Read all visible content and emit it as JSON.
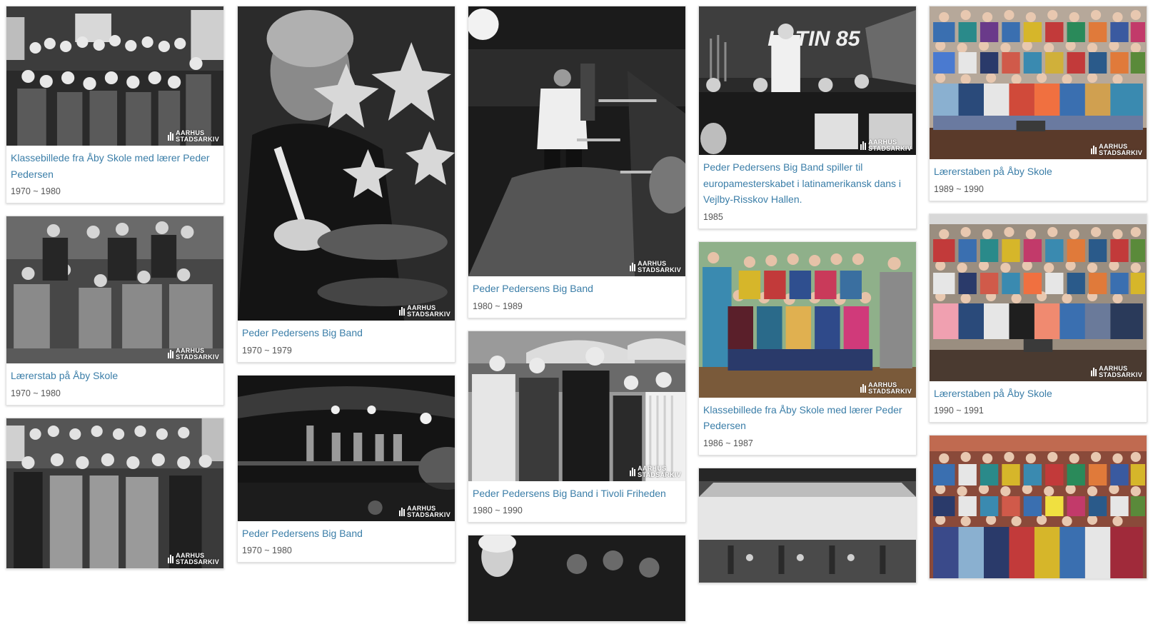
{
  "watermark": {
    "line1": "AARHUS",
    "line2": "STADSARKIV"
  },
  "columns": [
    [
      {
        "title": "Klassebillede fra Åby Skole med lærer Peder Pedersen",
        "date": "1970 ~ 1980",
        "photo": "bw-class-photo-icon"
      },
      {
        "title": "Lærerstab på Åby Skole",
        "date": "1970 ~ 1980",
        "photo": "bw-group-photo-icon"
      },
      {
        "title": "",
        "date": "",
        "photo": "bw-class-photo-icon"
      }
    ],
    [
      {
        "title": "Peder Pedersens Big Band",
        "date": "1970 ~ 1979",
        "photo": "bw-drummer-photo-icon"
      },
      {
        "title": "Peder Pedersens Big Band",
        "date": "1970 ~ 1980",
        "photo": "bw-stage-photo-icon"
      }
    ],
    [
      {
        "title": "Peder Pedersens Big Band",
        "date": "1980 ~ 1989",
        "photo": "bw-conductor-photo-icon"
      },
      {
        "title": "Peder Pedersens Big Band i Tivoli Friheden",
        "date": "1980 ~ 1990",
        "photo": "bw-people-photo-icon"
      },
      {
        "title": "",
        "date": "",
        "photo": "bw-portrait-photo-icon"
      }
    ],
    [
      {
        "title": "Peder Pedersens Big Band spiller til europamesterskabet i latinamerikansk dans i Vejlby-Risskov Hallen.",
        "date": "1985",
        "photo": "bw-bigband-photo-icon",
        "sign": "LATIN 85"
      },
      {
        "title": "Klassebillede fra Åby Skole med lærer Peder Pedersen",
        "date": "1986 ~ 1987",
        "photo": "color-class-photo-icon"
      },
      {
        "title": "",
        "date": "",
        "photo": "bw-pavilion-photo-icon"
      }
    ],
    [
      {
        "title": "Lærerstaben på Åby Skole",
        "date": "1989 ~ 1990",
        "photo": "color-staff-photo-icon"
      },
      {
        "title": "Lærerstaben på Åby Skole",
        "date": "1990 ~ 1991",
        "photo": "color-staff-photo-icon"
      },
      {
        "title": "",
        "date": "",
        "photo": "color-staff-photo-icon"
      }
    ]
  ]
}
